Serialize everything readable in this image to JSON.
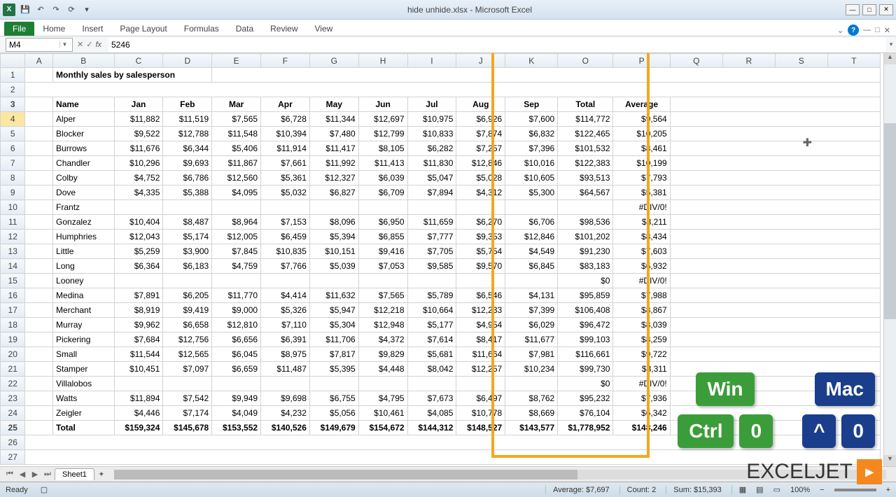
{
  "window": {
    "title": "hide unhide.xlsx - Microsoft Excel",
    "app_icon": "X"
  },
  "qat": {
    "save": "💾",
    "undo": "↶",
    "redo": "↷",
    "refresh": "⟳",
    "more": "▾"
  },
  "ribbon": {
    "tabs": [
      "File",
      "Home",
      "Insert",
      "Page Layout",
      "Formulas",
      "Data",
      "Review",
      "View"
    ]
  },
  "name_box": "M4",
  "formula": "5246",
  "columns": [
    "A",
    "B",
    "C",
    "D",
    "E",
    "F",
    "G",
    "H",
    "I",
    "J",
    "K",
    "O",
    "P",
    "Q",
    "R",
    "S",
    "T"
  ],
  "headers": [
    "Name",
    "Jan",
    "Feb",
    "Mar",
    "Apr",
    "May",
    "Jun",
    "Jul",
    "Aug",
    "Sep",
    "Total",
    "Average"
  ],
  "title_cell": "Monthly sales by salesperson",
  "rows": [
    {
      "r": 4,
      "n": "Alper",
      "v": [
        "$11,882",
        "$11,519",
        "$7,565",
        "$6,728",
        "$11,344",
        "$12,697",
        "$10,975",
        "$6,926",
        "$7,600",
        "$114,772",
        "$9,564"
      ]
    },
    {
      "r": 5,
      "n": "Blocker",
      "v": [
        "$9,522",
        "$12,788",
        "$11,548",
        "$10,394",
        "$7,480",
        "$12,799",
        "$10,833",
        "$7,874",
        "$6,832",
        "$122,465",
        "$10,205"
      ]
    },
    {
      "r": 6,
      "n": "Burrows",
      "v": [
        "$11,676",
        "$6,344",
        "$5,406",
        "$11,914",
        "$11,417",
        "$8,105",
        "$6,282",
        "$7,257",
        "$7,396",
        "$101,532",
        "$8,461"
      ]
    },
    {
      "r": 7,
      "n": "Chandler",
      "v": [
        "$10,296",
        "$9,693",
        "$11,867",
        "$7,661",
        "$11,992",
        "$11,413",
        "$11,830",
        "$12,846",
        "$10,016",
        "$122,383",
        "$10,199"
      ]
    },
    {
      "r": 8,
      "n": "Colby",
      "v": [
        "$4,752",
        "$6,786",
        "$12,560",
        "$5,361",
        "$12,327",
        "$6,039",
        "$5,047",
        "$5,028",
        "$10,605",
        "$93,513",
        "$7,793"
      ]
    },
    {
      "r": 9,
      "n": "Dove",
      "v": [
        "$4,335",
        "$5,388",
        "$4,095",
        "$5,032",
        "$6,827",
        "$6,709",
        "$7,894",
        "$4,312",
        "$5,300",
        "$64,567",
        "$5,381"
      ]
    },
    {
      "r": 10,
      "n": "Frantz",
      "v": [
        "",
        "",
        "",
        "",
        "",
        "",
        "",
        "",
        "",
        "",
        "#DIV/0!"
      ]
    },
    {
      "r": 11,
      "n": "Gonzalez",
      "v": [
        "$10,404",
        "$8,487",
        "$8,964",
        "$7,153",
        "$8,096",
        "$6,950",
        "$11,659",
        "$6,270",
        "$6,706",
        "$98,536",
        "$8,211"
      ]
    },
    {
      "r": 12,
      "n": "Humphries",
      "v": [
        "$12,043",
        "$5,174",
        "$12,005",
        "$6,459",
        "$5,394",
        "$6,855",
        "$7,777",
        "$9,353",
        "$12,846",
        "$101,202",
        "$8,434"
      ]
    },
    {
      "r": 13,
      "n": "Little",
      "v": [
        "$5,259",
        "$3,900",
        "$7,845",
        "$10,835",
        "$10,151",
        "$9,416",
        "$7,705",
        "$5,754",
        "$4,549",
        "$91,230",
        "$7,603"
      ]
    },
    {
      "r": 14,
      "n": "Long",
      "v": [
        "$6,364",
        "$6,183",
        "$4,759",
        "$7,766",
        "$5,039",
        "$7,053",
        "$9,585",
        "$9,570",
        "$6,845",
        "$83,183",
        "$6,932"
      ]
    },
    {
      "r": 15,
      "n": "Looney",
      "v": [
        "",
        "",
        "",
        "",
        "",
        "",
        "",
        "",
        "",
        "$0",
        "#DIV/0!"
      ]
    },
    {
      "r": 16,
      "n": "Medina",
      "v": [
        "$7,891",
        "$6,205",
        "$11,770",
        "$4,414",
        "$11,632",
        "$7,565",
        "$5,789",
        "$6,546",
        "$4,131",
        "$95,859",
        "$7,988"
      ]
    },
    {
      "r": 17,
      "n": "Merchant",
      "v": [
        "$8,919",
        "$9,419",
        "$9,000",
        "$5,326",
        "$5,947",
        "$12,218",
        "$10,664",
        "$12,233",
        "$7,399",
        "$106,408",
        "$8,867"
      ]
    },
    {
      "r": 18,
      "n": "Murray",
      "v": [
        "$9,962",
        "$6,658",
        "$12,810",
        "$7,110",
        "$5,304",
        "$12,948",
        "$5,177",
        "$4,954",
        "$6,029",
        "$96,472",
        "$8,039"
      ]
    },
    {
      "r": 19,
      "n": "Pickering",
      "v": [
        "$7,684",
        "$12,756",
        "$6,656",
        "$6,391",
        "$11,706",
        "$4,372",
        "$7,614",
        "$8,417",
        "$11,677",
        "$99,103",
        "$8,259"
      ]
    },
    {
      "r": 20,
      "n": "Small",
      "v": [
        "$11,544",
        "$12,565",
        "$6,045",
        "$8,975",
        "$7,817",
        "$9,829",
        "$5,681",
        "$11,664",
        "$7,981",
        "$116,661",
        "$9,722"
      ]
    },
    {
      "r": 21,
      "n": "Stamper",
      "v": [
        "$10,451",
        "$7,097",
        "$6,659",
        "$11,487",
        "$5,395",
        "$4,448",
        "$8,042",
        "$12,257",
        "$10,234",
        "$99,730",
        "$8,311"
      ]
    },
    {
      "r": 22,
      "n": "Villalobos",
      "v": [
        "",
        "",
        "",
        "",
        "",
        "",
        "",
        "",
        "",
        "$0",
        "#DIV/0!"
      ]
    },
    {
      "r": 23,
      "n": "Watts",
      "v": [
        "$11,894",
        "$7,542",
        "$9,949",
        "$9,698",
        "$6,755",
        "$4,795",
        "$7,673",
        "$6,497",
        "$8,762",
        "$95,232",
        "$7,936"
      ]
    },
    {
      "r": 24,
      "n": "Zeigler",
      "v": [
        "$4,446",
        "$7,174",
        "$4,049",
        "$4,232",
        "$5,056",
        "$10,461",
        "$4,085",
        "$10,778",
        "$8,669",
        "$76,104",
        "$6,342"
      ]
    },
    {
      "r": 25,
      "n": "Total",
      "v": [
        "$159,324",
        "$145,678",
        "$153,552",
        "$140,526",
        "$149,679",
        "$154,672",
        "$144,312",
        "$148,527",
        "$143,577",
        "$1,778,952",
        "$148,246"
      ]
    }
  ],
  "sheet": {
    "tab": "Sheet1"
  },
  "status": {
    "ready": "Ready",
    "average": "Average: $7,697",
    "count": "Count: 2",
    "sum": "Sum: $15,393",
    "zoom": "100%"
  },
  "overlay": {
    "win": "Win",
    "mac": "Mac",
    "ctrl": "Ctrl",
    "zero1": "0",
    "chev": "^",
    "zero2": "0",
    "logo_text": "EXCELJET",
    "logo_arrow": "▸"
  }
}
